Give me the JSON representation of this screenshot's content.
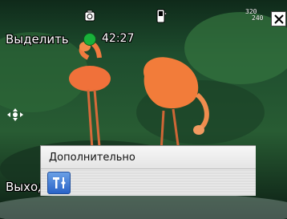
{
  "top_bar": {
    "icons": [
      "speaker-icon",
      "phone-signal-icon"
    ],
    "resolution": {
      "top": "320",
      "bottom": "240"
    },
    "close_icon": "close-icon"
  },
  "overlay": {
    "select_label": "Выделить",
    "timer": "42:27",
    "exit_label": "Выход",
    "focus_icon": "focus-cross-icon"
  },
  "popup": {
    "title": "Дополнительно",
    "tools_icon": "tools-icon"
  },
  "colors": {
    "record_dot": "#19b13a",
    "popup_bg": "#e9e9e9",
    "tools_button": "#2a63c7"
  }
}
